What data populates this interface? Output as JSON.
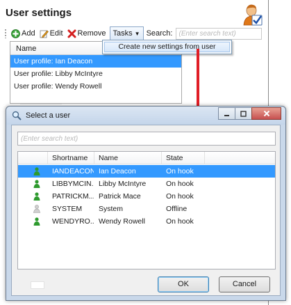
{
  "settings": {
    "title": "User settings",
    "toolbar": {
      "add_label": "Add",
      "edit_label": "Edit",
      "remove_label": "Remove",
      "tasks_label": "Tasks",
      "search_label": "Search:",
      "search_placeholder": "(Enter search text)"
    },
    "list": {
      "column_name": "Name",
      "rows": [
        {
          "label": "User profile: Ian Deacon",
          "selected": true
        },
        {
          "label": "User profile: Libby McIntyre",
          "selected": false
        },
        {
          "label": "User profile: Wendy Rowell",
          "selected": false
        }
      ]
    },
    "tasks_menu": {
      "items": [
        "Create new settings from user"
      ]
    }
  },
  "dialog": {
    "title": "Select a user",
    "search_placeholder": "(Enter search text)",
    "columns": {
      "shortname": "Shortname",
      "name": "Name",
      "state": "State"
    },
    "rows": [
      {
        "shortname": "IANDEACON",
        "name": "Ian Deacon",
        "state": "On hook",
        "icon": "user-green-icon",
        "selected": true
      },
      {
        "shortname": "LIBBYMCIN...",
        "name": "Libby McIntyre",
        "state": "On hook",
        "icon": "user-green-icon",
        "selected": false
      },
      {
        "shortname": "PATRICKM...",
        "name": "Patrick Mace",
        "state": "On hook",
        "icon": "user-green-icon",
        "selected": false
      },
      {
        "shortname": "SYSTEM",
        "name": "System",
        "state": "Offline",
        "icon": "user-gray-icon",
        "selected": false
      },
      {
        "shortname": "WENDYRO...",
        "name": "Wendy Rowell",
        "state": "On hook",
        "icon": "user-green-icon",
        "selected": false
      }
    ],
    "ok_label": "OK",
    "cancel_label": "Cancel"
  },
  "colors": {
    "selection": "#3399ff",
    "arrow": "#e01e26",
    "user_online": "#2e9a2e",
    "user_offline": "#b8b8b8"
  }
}
